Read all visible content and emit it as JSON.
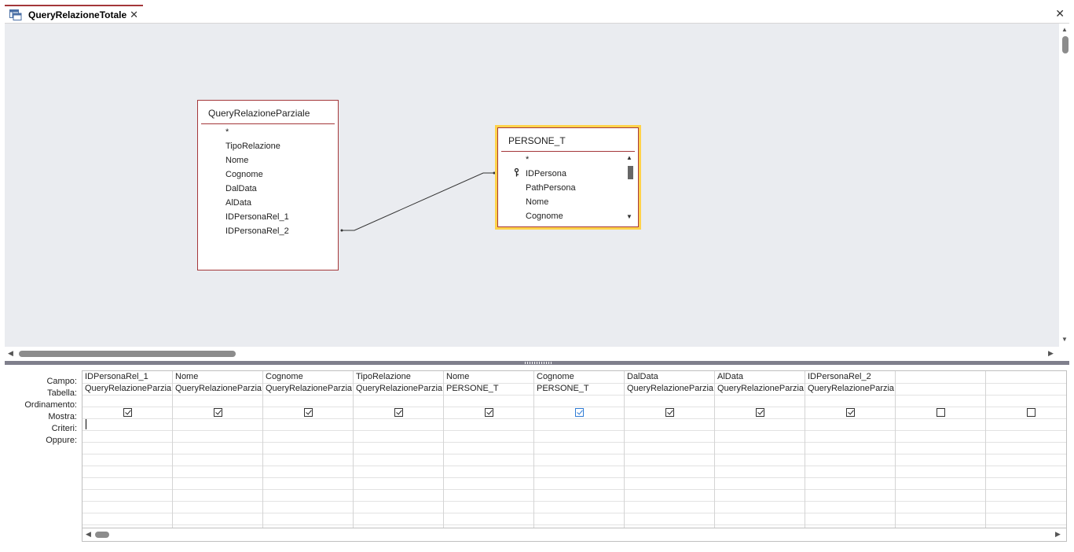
{
  "tab": {
    "title": "QueryRelazioneTotale",
    "close": "✕"
  },
  "doc_close": "✕",
  "tables": {
    "left": {
      "title": "QueryRelazioneParziale",
      "fields": [
        "*",
        "TipoRelazione",
        "Nome",
        "Cognome",
        "DalData",
        "AlData",
        "IDPersonaRel_1",
        "IDPersonaRel_2"
      ]
    },
    "right": {
      "title": "PERSONE_T",
      "fields": [
        "*",
        "IDPersona",
        "PathPersona",
        "Nome",
        "Cognome"
      ],
      "key_field": "IDPersona"
    }
  },
  "row_labels": [
    "Campo:",
    "Tabella:",
    "Ordinamento:",
    "Mostra:",
    "Criteri:",
    "Oppure:"
  ],
  "grid": {
    "columns": [
      {
        "campo": "IDPersonaRel_1",
        "tabella": "QueryRelazioneParzia",
        "mostra": true
      },
      {
        "campo": "Nome",
        "tabella": "QueryRelazioneParzia",
        "mostra": true
      },
      {
        "campo": "Cognome",
        "tabella": "QueryRelazioneParzia",
        "mostra": true
      },
      {
        "campo": "TipoRelazione",
        "tabella": "QueryRelazioneParzia",
        "mostra": true
      },
      {
        "campo": "Nome",
        "tabella": "PERSONE_T",
        "mostra": true
      },
      {
        "campo": "Cognome",
        "tabella": "PERSONE_T",
        "mostra": true
      },
      {
        "campo": "DalData",
        "tabella": "QueryRelazioneParzia",
        "mostra": true
      },
      {
        "campo": "AlData",
        "tabella": "QueryRelazioneParzia",
        "mostra": true
      },
      {
        "campo": "IDPersonaRel_2",
        "tabella": "QueryRelazioneParzia",
        "mostra": true
      },
      {
        "campo": "",
        "tabella": "",
        "mostra": false
      },
      {
        "campo": "",
        "tabella": "",
        "mostra": false
      }
    ]
  },
  "colors": {
    "accent": "#a4373a",
    "selection": "#ffd24a",
    "designer_bg": "#eaecf0"
  }
}
